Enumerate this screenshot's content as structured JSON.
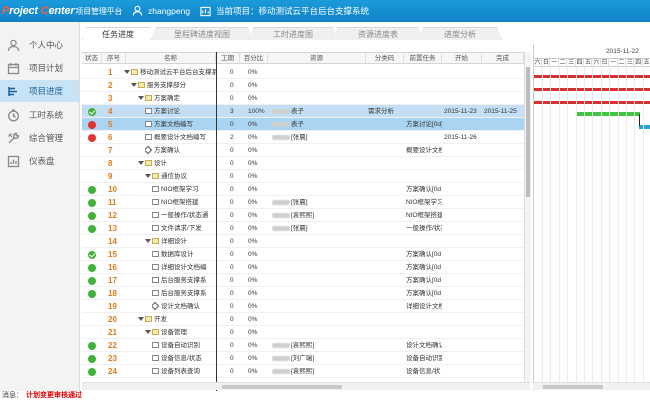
{
  "app": {
    "logo_left": "P",
    "logo_mid": "roject ",
    "logo_c": "C",
    "logo_rest": "enter",
    "logo_sub": "项目管理平台",
    "user": "zhangpeng",
    "current_project": "当前项目：移动测试云平台后台支撑系统",
    "brand_color": "#1b9bdc"
  },
  "sidebar": {
    "items": [
      {
        "label": "个人中心",
        "icon": "person-icon"
      },
      {
        "label": "项目计划",
        "icon": "calendar-icon"
      },
      {
        "label": "项目进度",
        "icon": "progress-icon"
      },
      {
        "label": "工时系统",
        "icon": "clock-icon"
      },
      {
        "label": "综合管理",
        "icon": "tools-icon"
      },
      {
        "label": "仪表盘",
        "icon": "dashboard-icon"
      }
    ],
    "active_index": 2
  },
  "tabs": [
    "任务进度",
    "里程碑进度视图",
    "工时进度图",
    "资源进度表",
    "进度分析"
  ],
  "grid": {
    "headers": [
      "状态",
      "序号",
      "名称",
      "工期",
      "百分比",
      "资源",
      "分类码",
      "前置任务",
      "开始",
      "完成"
    ],
    "rows": [
      {
        "status": "",
        "no": "1",
        "name": "移动测试云平台后台支撑系统",
        "dur": "0",
        "pct": "0%",
        "res": "",
        "code": "",
        "pre": "",
        "start": "",
        "end": "",
        "lvl": 0,
        "type": "group"
      },
      {
        "status": "",
        "no": "2",
        "name": "服务支撑部分",
        "dur": "0",
        "pct": "0%",
        "res": "",
        "code": "",
        "pre": "",
        "start": "",
        "end": "",
        "lvl": 1,
        "type": "group"
      },
      {
        "status": "",
        "no": "3",
        "name": "方案确定",
        "dur": "0",
        "pct": "0%",
        "res": "",
        "code": "",
        "pre": "",
        "start": "",
        "end": "",
        "lvl": 2,
        "type": "group"
      },
      {
        "status": "gc",
        "no": "4",
        "name": "方案讨论",
        "dur": "3",
        "pct": "100%",
        "res": "表子",
        "code": "需求分析",
        "pre": "",
        "start": "2015-11-23",
        "end": "2015-11-25",
        "lvl": 3,
        "type": "task",
        "hl": "sel"
      },
      {
        "status": "r",
        "no": "5",
        "name": "方案文档编写",
        "dur": "0",
        "pct": "0%",
        "res": "表子",
        "code": "",
        "pre": "方案讨论[0d]",
        "start": "",
        "end": "",
        "lvl": 3,
        "type": "task",
        "hl": "sel2"
      },
      {
        "status": "r",
        "no": "6",
        "name": "概要设计文档编写",
        "dur": "2",
        "pct": "0%",
        "res": "[张晨]",
        "code": "",
        "pre": "",
        "start": "2015-11-26",
        "end": "",
        "lvl": 3,
        "type": "task"
      },
      {
        "status": "",
        "no": "7",
        "name": "方案确认",
        "dur": "0",
        "pct": "0%",
        "res": "",
        "code": "",
        "pre": "概要设计文档",
        "start": "",
        "end": "",
        "lvl": 3,
        "type": "milestone"
      },
      {
        "status": "",
        "no": "8",
        "name": "设计",
        "dur": "0",
        "pct": "0%",
        "res": "",
        "code": "",
        "pre": "",
        "start": "",
        "end": "",
        "lvl": 2,
        "type": "group"
      },
      {
        "status": "",
        "no": "9",
        "name": "通信协议",
        "dur": "0",
        "pct": "0%",
        "res": "",
        "code": "",
        "pre": "",
        "start": "",
        "end": "",
        "lvl": 3,
        "type": "group"
      },
      {
        "status": "g",
        "no": "10",
        "name": "NIO框架学习",
        "dur": "0",
        "pct": "0%",
        "res": "",
        "code": "",
        "pre": "方案确认[0d",
        "start": "",
        "end": "",
        "lvl": 4,
        "type": "task"
      },
      {
        "status": "g",
        "no": "11",
        "name": "NIO框架搭建",
        "dur": "0",
        "pct": "0%",
        "res": "[张晨]",
        "code": "",
        "pre": "NIO框架学习",
        "start": "",
        "end": "",
        "lvl": 4,
        "type": "task"
      },
      {
        "status": "g",
        "no": "12",
        "name": "一般操作/状态通",
        "dur": "0",
        "pct": "0%",
        "res": "[袁熙熙]",
        "code": "",
        "pre": "NIO框架搭建",
        "start": "",
        "end": "",
        "lvl": 4,
        "type": "task"
      },
      {
        "status": "g",
        "no": "13",
        "name": "文件请求/下发",
        "dur": "0",
        "pct": "0%",
        "res": "[张晨]",
        "code": "",
        "pre": "一般操作/状态",
        "start": "",
        "end": "",
        "lvl": 4,
        "type": "task"
      },
      {
        "status": "",
        "no": "14",
        "name": "详细设计",
        "dur": "0",
        "pct": "0%",
        "res": "",
        "code": "",
        "pre": "",
        "start": "",
        "end": "",
        "lvl": 3,
        "type": "group"
      },
      {
        "status": "gc",
        "no": "15",
        "name": "数据库设计",
        "dur": "0",
        "pct": "0%",
        "res": "",
        "code": "",
        "pre": "方案确认[0d",
        "start": "",
        "end": "",
        "lvl": 4,
        "type": "task"
      },
      {
        "status": "g",
        "no": "16",
        "name": "详细设计文档编",
        "dur": "0",
        "pct": "0%",
        "res": "",
        "code": "",
        "pre": "方案确认[0d",
        "start": "",
        "end": "",
        "lvl": 4,
        "type": "task"
      },
      {
        "status": "g",
        "no": "17",
        "name": "后台服务支撑系",
        "dur": "0",
        "pct": "0%",
        "res": "",
        "code": "",
        "pre": "方案确认[0d",
        "start": "",
        "end": "",
        "lvl": 4,
        "type": "task"
      },
      {
        "status": "g",
        "no": "18",
        "name": "后台服务支撑系",
        "dur": "0",
        "pct": "0%",
        "res": "",
        "code": "",
        "pre": "方案确认[0d",
        "start": "",
        "end": "",
        "lvl": 4,
        "type": "task"
      },
      {
        "status": "",
        "no": "19",
        "name": "设计文档确认",
        "dur": "0",
        "pct": "0%",
        "res": "",
        "code": "",
        "pre": "详细设计文档",
        "start": "",
        "end": "",
        "lvl": 4,
        "type": "milestone"
      },
      {
        "status": "",
        "no": "20",
        "name": "开发",
        "dur": "0",
        "pct": "0%",
        "res": "",
        "code": "",
        "pre": "",
        "start": "",
        "end": "",
        "lvl": 2,
        "type": "group"
      },
      {
        "status": "",
        "no": "21",
        "name": "设备管理",
        "dur": "0",
        "pct": "0%",
        "res": "",
        "code": "",
        "pre": "",
        "start": "",
        "end": "",
        "lvl": 3,
        "type": "group"
      },
      {
        "status": "g",
        "no": "22",
        "name": "设备自动识别",
        "dur": "0",
        "pct": "0%",
        "res": "[袁熙熙]",
        "code": "",
        "pre": "设计文档确认",
        "start": "",
        "end": "",
        "lvl": 4,
        "type": "task"
      },
      {
        "status": "g",
        "no": "23",
        "name": "设备信息/状态",
        "dur": "0",
        "pct": "0%",
        "res": "[刘广瑞]",
        "code": "",
        "pre": "设备自动识别",
        "start": "",
        "end": "",
        "lvl": 4,
        "type": "task"
      },
      {
        "status": "g",
        "no": "24",
        "name": "设备列表查询",
        "dur": "0",
        "pct": "0%",
        "res": "[袁熙熙]",
        "code": "",
        "pre": "设备信息/状",
        "start": "",
        "end": "",
        "lvl": 4,
        "type": "task"
      }
    ]
  },
  "gantt": {
    "date": "2015-11-22",
    "days": [
      "六",
      "日",
      "一",
      "二",
      "三",
      "四",
      "五",
      "六",
      "日",
      "一",
      "二",
      "三",
      "四",
      "五"
    ]
  },
  "status_bar": {
    "label": "消息：",
    "message": "计划变更审核通过"
  }
}
